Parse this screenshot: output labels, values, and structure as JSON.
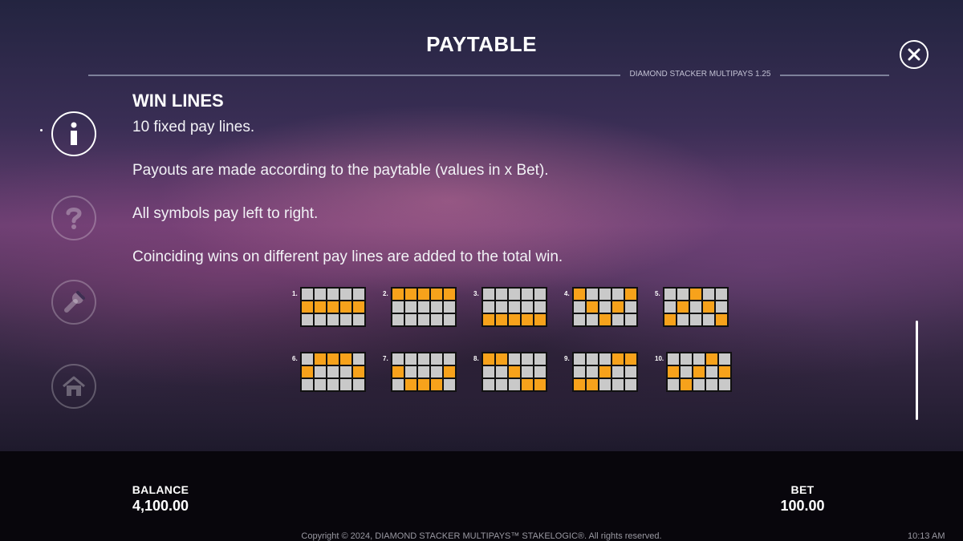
{
  "header": {
    "title": "PAYTABLE",
    "version": "DIAMOND STACKER MULTIPAYS 1.25"
  },
  "close_button": {
    "label": "X"
  },
  "sidebar": {
    "items": [
      {
        "icon": "info-icon",
        "active": true
      },
      {
        "icon": "question-icon",
        "active": false
      },
      {
        "icon": "wrench-icon",
        "active": false
      },
      {
        "icon": "home-icon",
        "active": false
      }
    ]
  },
  "content": {
    "heading": "WIN LINES",
    "paragraphs": [
      "10 fixed pay lines.",
      "Payouts are made according to the paytable (values in x Bet).",
      "All symbols pay left to right.",
      "Coinciding wins on different pay lines are added to the total win."
    ]
  },
  "paylines": [
    {
      "label": "1.",
      "rows": [
        1,
        1,
        1,
        1,
        1
      ]
    },
    {
      "label": "2.",
      "rows": [
        0,
        0,
        0,
        0,
        0
      ]
    },
    {
      "label": "3.",
      "rows": [
        2,
        2,
        2,
        2,
        2
      ]
    },
    {
      "label": "4.",
      "rows": [
        0,
        1,
        2,
        1,
        0
      ]
    },
    {
      "label": "5.",
      "rows": [
        2,
        1,
        0,
        1,
        2
      ]
    },
    {
      "label": "6.",
      "rows": [
        1,
        0,
        0,
        0,
        1
      ]
    },
    {
      "label": "7.",
      "rows": [
        1,
        2,
        2,
        2,
        1
      ]
    },
    {
      "label": "8.",
      "rows": [
        0,
        0,
        1,
        2,
        2
      ]
    },
    {
      "label": "9.",
      "rows": [
        2,
        2,
        1,
        0,
        0
      ]
    },
    {
      "label": "10.",
      "rows": [
        1,
        2,
        1,
        0,
        1
      ]
    }
  ],
  "colors": {
    "highlight": "#F7A21B",
    "cell": "#C9C9C9",
    "grid_border": "#111111"
  },
  "footer": {
    "balance_label": "BALANCE",
    "balance_value": "4,100.00",
    "bet_label": "BET",
    "bet_value": "100.00",
    "copyright": "Copyright © 2024, DIAMOND STACKER MULTIPAYS™ STAKELOGIC®. All rights reserved.",
    "clock": "10:13 AM"
  }
}
